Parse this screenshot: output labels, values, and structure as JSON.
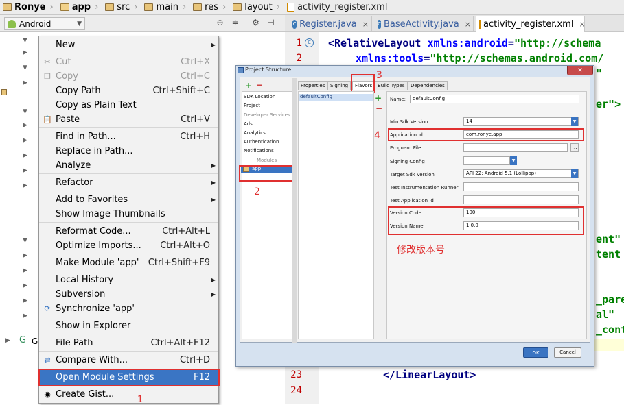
{
  "breadcrumb": {
    "items": [
      "Ronye",
      "app",
      "src",
      "main",
      "res",
      "layout",
      "activity_register.xml"
    ]
  },
  "project_bar": {
    "view_label": "Android",
    "tree_item_label": "G"
  },
  "editor": {
    "tabs": [
      {
        "label": "Register.java",
        "type": "java"
      },
      {
        "label": "BaseActivity.java",
        "type": "java"
      },
      {
        "label": "activity_register.xml",
        "type": "xml",
        "active": true
      }
    ],
    "line_numbers": [
      "1",
      "2",
      "23",
      "24"
    ],
    "code": {
      "line1_tag": "<RelativeLayout",
      "line1_attr": " xmlns:android",
      "line1_eq": "=",
      "line1_val": "\"http://schema",
      "line2_attr": "xmlns:tools",
      "line2_eq": "=",
      "line2_val": "\"http://schemas.android.com/",
      "frag_a": "\"",
      "frag_b": "er\">",
      "frag_c": "ent\"",
      "frag_d": "tent",
      "frag_e": "_pare",
      "frag_f": "al\"",
      "frag_g": "_cont",
      "line23": "</LinearLayout>"
    }
  },
  "context_menu": {
    "items": [
      {
        "label": "New",
        "shortcut": "",
        "submenu": true,
        "disabled": false,
        "icon": ""
      },
      {
        "label": "Cut",
        "shortcut": "Ctrl+X",
        "submenu": false,
        "disabled": true,
        "icon": "scissors-icon"
      },
      {
        "label": "Copy",
        "shortcut": "Ctrl+C",
        "submenu": false,
        "disabled": true,
        "icon": "copy-icon"
      },
      {
        "label": "Copy Path",
        "shortcut": "Ctrl+Shift+C",
        "submenu": false,
        "disabled": false,
        "icon": ""
      },
      {
        "label": "Copy as Plain Text",
        "shortcut": "",
        "submenu": false,
        "disabled": false,
        "icon": ""
      },
      {
        "label": "Paste",
        "shortcut": "Ctrl+V",
        "submenu": false,
        "disabled": false,
        "icon": "paste-icon"
      },
      {
        "label": "Find in Path...",
        "shortcut": "Ctrl+H",
        "submenu": false,
        "disabled": false,
        "icon": ""
      },
      {
        "label": "Replace in Path...",
        "shortcut": "",
        "submenu": false,
        "disabled": false,
        "icon": ""
      },
      {
        "label": "Analyze",
        "shortcut": "",
        "submenu": true,
        "disabled": false,
        "icon": ""
      },
      {
        "label": "Refactor",
        "shortcut": "",
        "submenu": true,
        "disabled": false,
        "icon": ""
      },
      {
        "label": "Add to Favorites",
        "shortcut": "",
        "submenu": true,
        "disabled": false,
        "icon": ""
      },
      {
        "label": "Show Image Thumbnails",
        "shortcut": "",
        "submenu": false,
        "disabled": false,
        "icon": ""
      },
      {
        "label": "Reformat Code...",
        "shortcut": "Ctrl+Alt+L",
        "submenu": false,
        "disabled": false,
        "icon": ""
      },
      {
        "label": "Optimize Imports...",
        "shortcut": "Ctrl+Alt+O",
        "submenu": false,
        "disabled": false,
        "icon": ""
      },
      {
        "label": "Make Module 'app'",
        "shortcut": "Ctrl+Shift+F9",
        "submenu": false,
        "disabled": false,
        "icon": ""
      },
      {
        "label": "Local History",
        "shortcut": "",
        "submenu": true,
        "disabled": false,
        "icon": ""
      },
      {
        "label": "Subversion",
        "shortcut": "",
        "submenu": true,
        "disabled": false,
        "icon": ""
      },
      {
        "label": "Synchronize 'app'",
        "shortcut": "",
        "submenu": false,
        "disabled": false,
        "icon": "sync-icon"
      },
      {
        "label": "Show in Explorer",
        "shortcut": "",
        "submenu": false,
        "disabled": false,
        "icon": ""
      },
      {
        "label": "File Path",
        "shortcut": "Ctrl+Alt+F12",
        "submenu": false,
        "disabled": false,
        "icon": ""
      },
      {
        "label": "Compare With...",
        "shortcut": "Ctrl+D",
        "submenu": false,
        "disabled": false,
        "icon": "compare-icon"
      },
      {
        "label": "Open Module Settings",
        "shortcut": "F12",
        "submenu": false,
        "disabled": false,
        "icon": "",
        "highlighted": true
      },
      {
        "label": "Create Gist...",
        "shortcut": "",
        "submenu": false,
        "disabled": false,
        "icon": "github-icon"
      }
    ],
    "annotation": "1"
  },
  "dialog": {
    "title": "Project Structure",
    "left_items": [
      "SDK Location",
      "Project",
      "Developer Services",
      "Ads",
      "Analytics",
      "Authentication",
      "Notifications"
    ],
    "modules_header": "Modules",
    "module_item": "app",
    "tabs": [
      "Properties",
      "Signing",
      "Flavors",
      "Build Types",
      "Dependencies"
    ],
    "flavor_list_item": "defaultConfig",
    "fields": {
      "name_label": "Name:",
      "name_value": "defaultConfig",
      "min_sdk_label": "Min Sdk Version",
      "min_sdk_value": "14",
      "app_id_label": "Application Id",
      "app_id_value": "com.ronye.app",
      "proguard_label": "Proguard File",
      "signing_label": "Signing Config",
      "target_sdk_label": "Target Sdk Version",
      "target_sdk_value": "API 22: Android 5.1 (Lollipop)",
      "test_runner_label": "Test Instrumentation Runner",
      "test_app_id_label": "Test Application Id",
      "version_code_label": "Version Code",
      "version_code_value": "100",
      "version_name_label": "Version Name",
      "version_name_value": "1.0.0"
    },
    "ok_label": "OK",
    "cancel_label": "Cancel",
    "annotations": {
      "n2": "2",
      "n3": "3",
      "n4": "4",
      "note": "修改版本号"
    }
  },
  "colors": {
    "highlight": "#3a75c4",
    "annotation_red": "#e03030",
    "line_number": "#c00000"
  }
}
